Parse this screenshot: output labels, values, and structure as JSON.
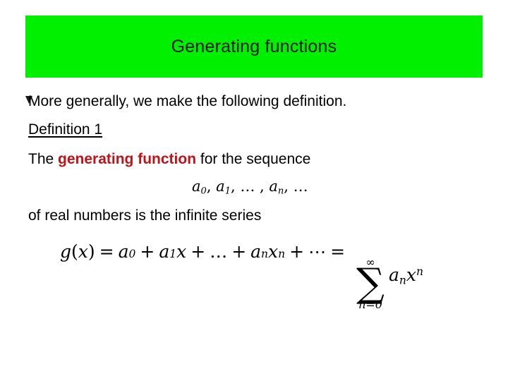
{
  "slide": {
    "title": "Generating functions",
    "title_banner_color": "#00f000",
    "title_text_color": "#1a1a1a",
    "background_color": "#ffffff",
    "accent_red": "#bf1219"
  },
  "body": {
    "bullet_icon": "triangle-bullet",
    "line1": "More generally, we make the following definition.",
    "line2": "Definition 1",
    "line3_prefix": "The ",
    "line3_emphasis": "generating function",
    "line3_suffix": " for the sequence",
    "line5": "of real numbers is the infinite series"
  },
  "math": {
    "sequence": {
      "a0": "a",
      "a0_sub": "0",
      "sep1": ", ",
      "a1": "a",
      "a1_sub": "1",
      "sep2": ", … , ",
      "an": "a",
      "an_sub": "n",
      "sep3": ", …"
    },
    "equation": {
      "gx": "g",
      "open": "(",
      "x": "x",
      "close": ")",
      "equals": "=",
      "t1": "a",
      "t1_sub": "0",
      "plus1": "+",
      "t2": "a",
      "t2_sub": "1",
      "t2_x": "x",
      "plus2": "+",
      "ellipsis": "…",
      "plus3": "+",
      "t3": "a",
      "t3_sub": "n",
      "t3_x": "x",
      "t3_sup": "n",
      "plus4": "+",
      "cdots": "⋯",
      "equals2": "=",
      "sum_symbol": "∑",
      "sum_upper": "∞",
      "sum_lower": "n=0",
      "sum_body_a": "a",
      "sum_body_a_sub": "n",
      "sum_body_x": "x",
      "sum_body_x_sup": "n"
    }
  }
}
